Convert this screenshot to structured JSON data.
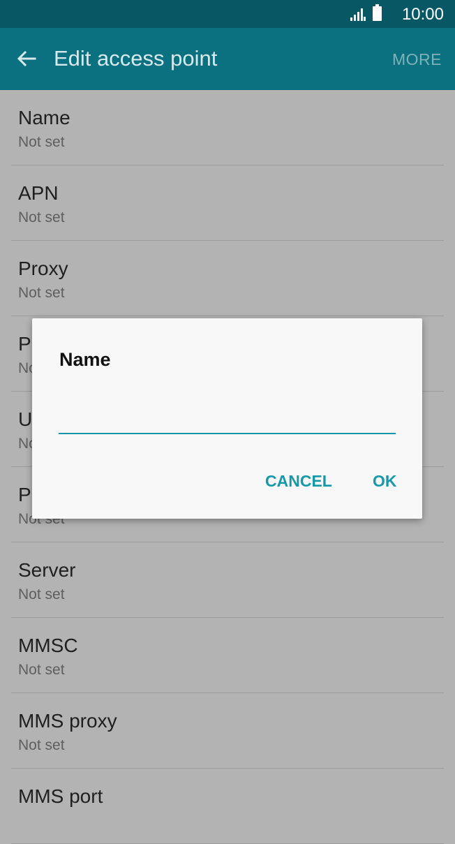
{
  "status_bar": {
    "time": "10:00",
    "icons": [
      "signal-icon",
      "battery-icon"
    ]
  },
  "app_bar": {
    "title": "Edit access point",
    "more": "MORE",
    "back_icon": "arrow-left-icon"
  },
  "settings": [
    {
      "label": "Name",
      "value": "Not set"
    },
    {
      "label": "APN",
      "value": "Not set"
    },
    {
      "label": "Proxy",
      "value": "Not set"
    },
    {
      "label": "P",
      "value": "No"
    },
    {
      "label": "U",
      "value": "No"
    },
    {
      "label": "P",
      "value": "Not set"
    },
    {
      "label": "Server",
      "value": "Not set"
    },
    {
      "label": "MMSC",
      "value": "Not set"
    },
    {
      "label": "MMS proxy",
      "value": "Not set"
    },
    {
      "label": "MMS port",
      "value": ""
    }
  ],
  "dialog": {
    "title": "Name",
    "input_value": "",
    "cancel": "CANCEL",
    "ok": "OK"
  },
  "colors": {
    "status_bar": "#075765",
    "app_bar": "#0b7180",
    "accent": "#1798a8",
    "scrim_background": "#b3b3b3"
  }
}
